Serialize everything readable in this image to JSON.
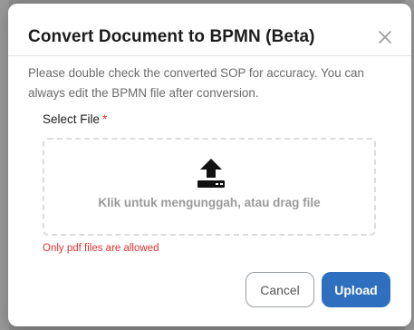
{
  "dialog": {
    "title": "Convert Document to BPMN (Beta)",
    "description": "Please double check the converted SOP for accuracy. You can always edit the BPMN file after conversion.",
    "close_icon": "close-icon"
  },
  "file_field": {
    "label": "Select File",
    "required_marker": "*",
    "dropzone_text": "Klik untuk mengunggah, atau drag file",
    "upload_icon": "upload-icon",
    "error": "Only pdf files are allowed"
  },
  "actions": {
    "cancel_label": "Cancel",
    "upload_label": "Upload"
  },
  "colors": {
    "primary": "#2f6fbf",
    "error": "#e03131"
  }
}
